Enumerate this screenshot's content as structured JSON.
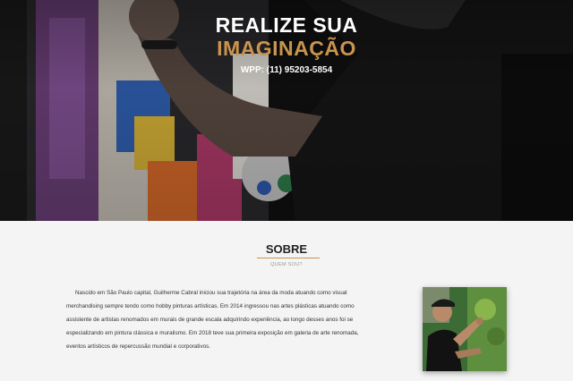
{
  "hero": {
    "line1": "REALIZE SUA",
    "line2": "IMAGINAÇÃO",
    "phone": "WPP: (11) 95203-5854",
    "image": "artist-painting-canvas"
  },
  "about": {
    "title": "SOBRE",
    "subtitle": "QUEM SOU?",
    "paragraph": "Nascido em São Paulo capital, Guilherme Cabral iniciou sua trajetória na área da moda atuando como visual merchandising sempre tendo como hobby pinturas artísticas. Em 2014 ingressou nas artes plásticas atuando como assistente de artistas renomados em murais de grande escala adquirindo experiência, ao longo desses anos foi se especializando em pintura clássica e muralismo. Em 2018 teve sua primeira exposição em galeria de arte renomada, eventos artísticos de repercussão mundial e corporativos.",
    "photo": "artist-portrait"
  },
  "colors": {
    "accent": "#c9944e",
    "background": "#f4f4f4",
    "hero_text": "#ffffff"
  }
}
